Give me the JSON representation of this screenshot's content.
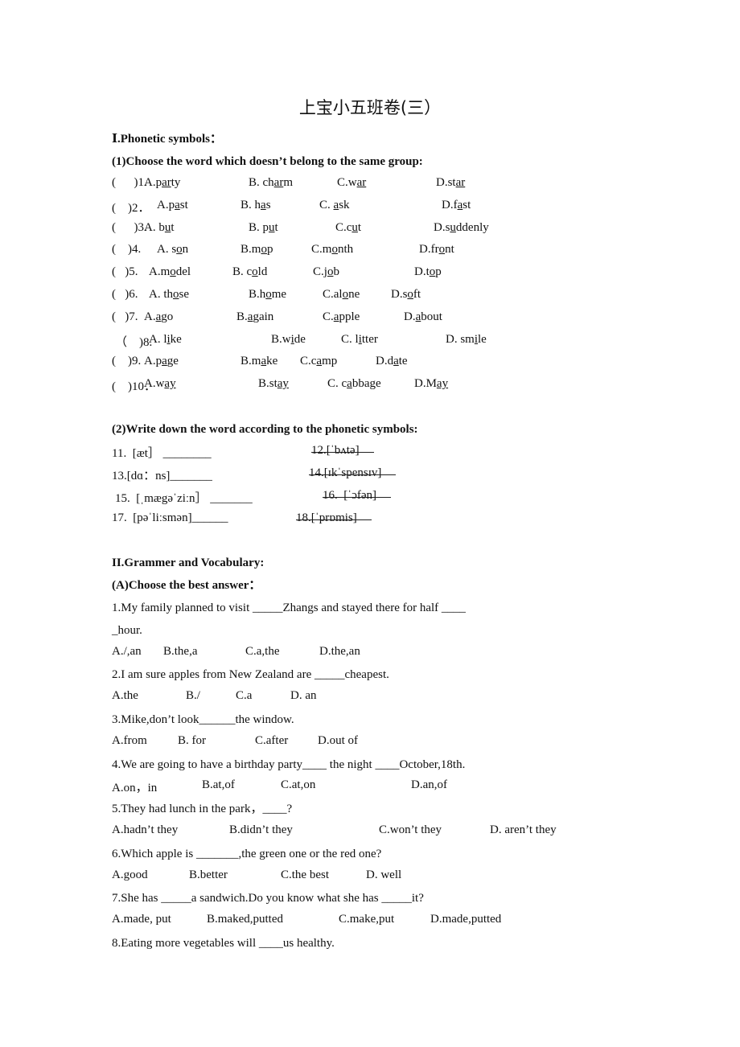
{
  "title": "上宝小五班卷(三）",
  "section1": {
    "heading": "Ⅰ.Phonetic symbols：",
    "part1": {
      "heading": "(1)Choose the word which doesn’t belong to the same group:",
      "questions": [
        {
          "num": "(      )1.",
          "options": [
            "A.party",
            "B. charm",
            "C.war",
            "D.star"
          ],
          "underlined": [
            "ar",
            "ar",
            "ar",
            "ar"
          ]
        },
        {
          "num": "(    )2．",
          "options": [
            "A.past",
            "B. has",
            "C. ask",
            "D.fast"
          ],
          "underlined": [
            "a",
            "a",
            "a",
            "a"
          ]
        },
        {
          "num": "(      )3.",
          "options": [
            "A. but",
            "B. put",
            "C.cut",
            "D.suddenly"
          ],
          "underlined": [
            "u",
            "u",
            "u",
            "u"
          ]
        },
        {
          "num": "(    )4.",
          "options": [
            "A. son",
            "B.mop",
            "C.month",
            "D.front"
          ],
          "underlined": [
            "o",
            "o",
            "o",
            "o"
          ]
        },
        {
          "num": "(   )5.",
          "options": [
            "A.model",
            "B. cold",
            "C.job",
            "D.top"
          ],
          "underlined": [
            "o",
            "o",
            "o",
            "o"
          ]
        },
        {
          "num": "(   )6.",
          "options": [
            "A. those",
            "B.home",
            "C.alone",
            "D.soft"
          ],
          "underlined": [
            "o",
            "o",
            "o",
            "o"
          ]
        },
        {
          "num": "(   )7.",
          "options": [
            "A.ago",
            "B.again",
            "C.apple",
            "D.about"
          ],
          "underlined": [
            "a",
            "a",
            "a",
            "a"
          ]
        },
        {
          "num": "（    )8.",
          "options": [
            "A. like",
            "B.wide",
            "C. litter",
            "D. smile"
          ],
          "underlined": [
            "i",
            "i",
            "i",
            "i"
          ]
        },
        {
          "num": "(    )9.",
          "options": [
            "A.page",
            "B.make",
            "C.camp",
            "D.date"
          ],
          "underlined": [
            "a",
            "a",
            "a",
            "a"
          ]
        },
        {
          "num": "(    )10．",
          "options": [
            "A.way",
            "B.stay",
            "C. cabbage",
            "D.May"
          ],
          "underlined": [
            "ay",
            "ay",
            "a",
            "ay"
          ]
        }
      ]
    },
    "part2": {
      "heading": "(2)Write down the word according to the phonetic symbols:",
      "items": [
        {
          "left": "11.  [æt］ ________",
          "right": "12.[ˈbʌtə]"
        },
        {
          "left": "13.[dɑ：ns]_______",
          "right": "14.[ɪkˈspensɪv]"
        },
        {
          "left": "15.  [ˌmægəˈziːn］ _______",
          "right": "16.  [ˈɔfən]"
        },
        {
          "left": "17.  [pəˈliːsmən]______",
          "right": "18.[ˈprɒmis]"
        }
      ]
    }
  },
  "section2": {
    "heading": "II.Grammer and Vocabulary:",
    "partA": {
      "heading": "(A)Choose the best answer：",
      "questions": [
        {
          "stem": "1.My family planned to visit _____Zhangs and stayed there for half ____",
          "stem_cont": "_hour.",
          "options": [
            "A./,an",
            "B.the,a",
            "C.a,the",
            "D.the,an"
          ]
        },
        {
          "stem": "2.I am sure apples from New Zealand are _____cheapest.",
          "options": [
            "A.the",
            "B./",
            "C.a",
            "D. an"
          ]
        },
        {
          "stem": "3.Mike,don’t look______the window.",
          "options": [
            "A.from",
            "B. for",
            "C.after",
            "D.out of"
          ]
        },
        {
          "stem": "4.We are going to have a birthday party____ the night ____October,18th.",
          "options": [
            "A.on，in",
            "B.at,of",
            "C.at,on",
            "D.an,of"
          ]
        },
        {
          "stem": "5.They had lunch in the park，____?",
          "options": [
            "A.hadn’t they",
            "B.didn’t they",
            "C.won’t they",
            "D. aren’t they"
          ]
        },
        {
          "stem": "6.Which apple is _______,the green one or the red one?",
          "options": [
            "A.good",
            "B.better",
            "C.the best",
            "D. well"
          ]
        },
        {
          "stem": "7.She has _____a sandwich.Do you know what she has _____it?",
          "options": [
            "A.made, put",
            "B.maked,putted",
            "C.make,put",
            "D.made,putted"
          ]
        },
        {
          "stem": "8.Eating more vegetables will ____us healthy."
        }
      ]
    }
  }
}
